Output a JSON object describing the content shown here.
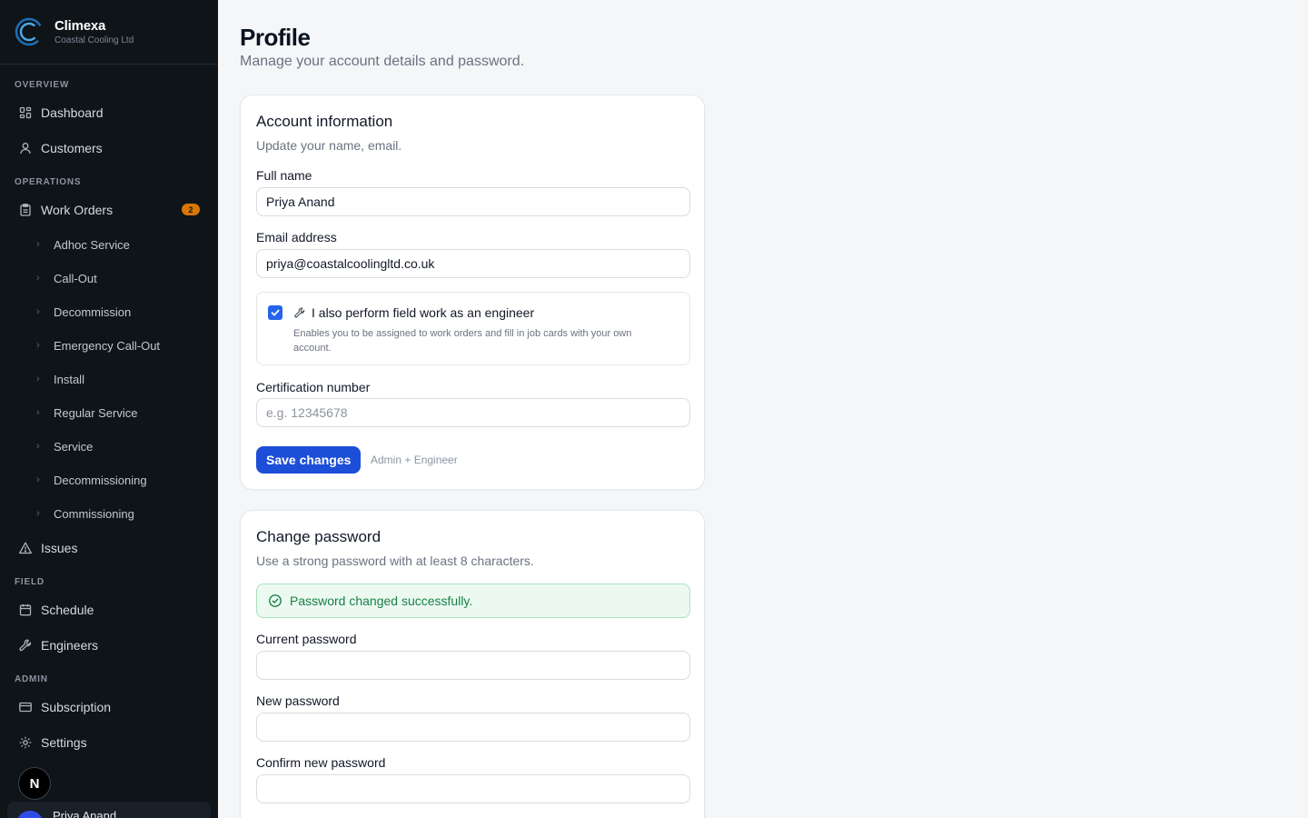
{
  "brand": {
    "name": "Climexa",
    "company": "Coastal Cooling Ltd"
  },
  "nav": {
    "overview_label": "OVERVIEW",
    "dashboard": "Dashboard",
    "customers": "Customers",
    "operations_label": "OPERATIONS",
    "work_orders": "Work Orders",
    "work_orders_badge": "2",
    "work_order_types": [
      "Adhoc Service",
      "Call-Out",
      "Decommission",
      "Emergency Call-Out",
      "Install",
      "Regular Service",
      "Service",
      "Decommissioning",
      "Commissioning"
    ],
    "issues": "Issues",
    "field_label": "FIELD",
    "schedule": "Schedule",
    "engineers": "Engineers",
    "admin_label": "ADMIN",
    "subscription": "Subscription",
    "settings": "Settings",
    "n_button": "N"
  },
  "user": {
    "name": "Priya Anand"
  },
  "page": {
    "title": "Profile",
    "subtitle": "Manage your account details and password."
  },
  "account": {
    "title": "Account information",
    "description": "Update your name, email.",
    "full_name_label": "Full name",
    "full_name_value": "Priya Anand",
    "email_label": "Email address",
    "email_value": "priya@coastalcoolingltd.co.uk",
    "engineer_checkbox_label": "I also perform field work as an engineer",
    "engineer_checkbox_checked": true,
    "engineer_checkbox_desc": "Enables you to be assigned to work orders and fill in job cards with your own account.",
    "cert_label": "Certification number",
    "cert_placeholder": "e.g. 12345678",
    "save_label": "Save changes",
    "role_note": "Admin + Engineer"
  },
  "password": {
    "title": "Change password",
    "description": "Use a strong password with at least 8 characters.",
    "success_message": "Password changed successfully.",
    "current_label": "Current password",
    "new_label": "New password",
    "confirm_label": "Confirm new password"
  },
  "colors": {
    "accent": "#1d4ed8",
    "sidebar_bg": "#0f1419",
    "success": "#18804a",
    "badge": "#d97706"
  }
}
